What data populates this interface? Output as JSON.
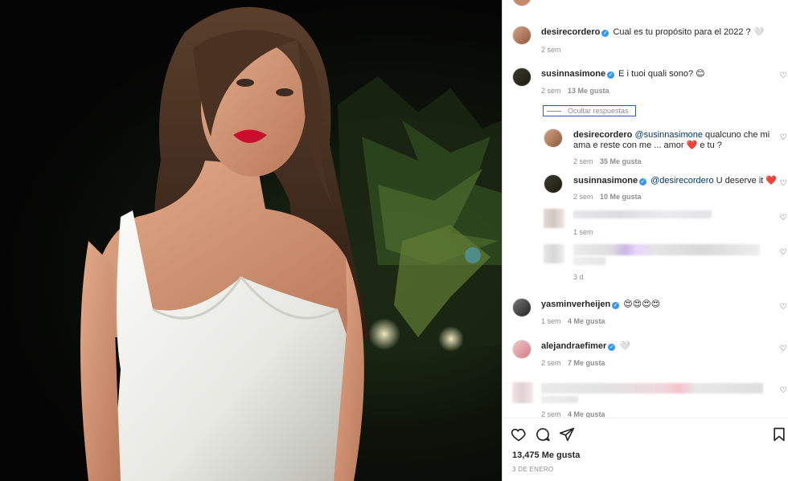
{
  "comments": [
    {
      "user": "desirecordero",
      "verified": true,
      "text": "Cual es tu propósito para el 2022 ? 🤍",
      "time": "2 sem",
      "likes": ""
    },
    {
      "user": "susinnasimone",
      "verified": true,
      "text": "E i tuoi quali sono? 😊",
      "time": "2 sem",
      "likes": "13 Me gusta"
    }
  ],
  "hide_replies_label": "Ocultar respuestas",
  "replies": [
    {
      "user": "desirecordero",
      "mention": "@susinnasimone",
      "text_line1": "qualcuno che mi",
      "text_line2": "ama e reste con me ... amor ❤️ e tu ?",
      "time": "2 sem",
      "likes": "35 Me gusta"
    },
    {
      "user": "susinnasimone",
      "verified": true,
      "mention": "@desirecordero",
      "text": "U deserve it ❤️",
      "time": "2 sem",
      "likes": "10 Me gusta"
    },
    {
      "time": "1 sem"
    },
    {
      "time": "3 d"
    }
  ],
  "more_comments": [
    {
      "user": "yasminverheijen",
      "verified": true,
      "text": "😍😍😍😍",
      "time": "1 sem",
      "likes": "4 Me gusta"
    },
    {
      "user": "alejandraefimer",
      "verified": true,
      "text": "🤍",
      "time": "2 sem",
      "likes": "7 Me gusta"
    },
    {
      "time": "2 sem",
      "likes": "4 Me gusta"
    }
  ],
  "footer": {
    "likes": "13,475 Me gusta",
    "date": "3 de enero"
  },
  "icons": [
    "heart-icon",
    "comment-icon",
    "share-icon",
    "bookmark-icon",
    "verified-icon"
  ],
  "colors": {
    "verified": "#3897f0",
    "mention": "#00376b",
    "meta": "#8e8e8e",
    "text": "#262626"
  }
}
